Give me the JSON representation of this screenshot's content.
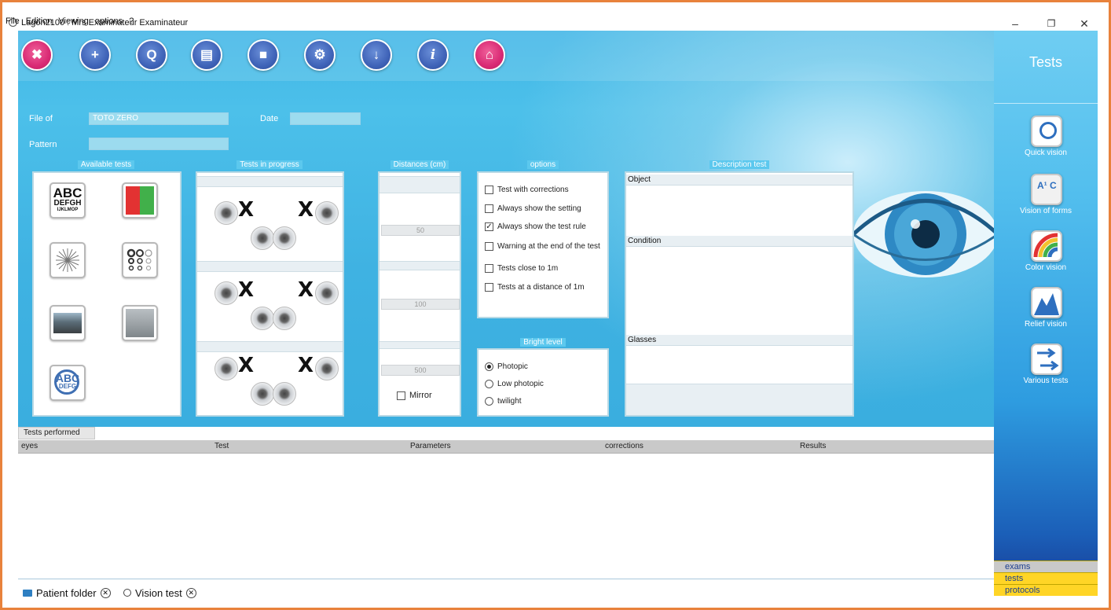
{
  "window": {
    "title": "Lagon2100 : Mrs Examinateur Examinateur",
    "minimize": "–",
    "restore": "❐",
    "close": "✕"
  },
  "menu": [
    "File",
    "Edition",
    "Viewing",
    "options",
    "?"
  ],
  "toolbar": {
    "buttons": [
      {
        "name": "close-session",
        "glyph": "✖"
      },
      {
        "name": "add-patient",
        "glyph": "+"
      },
      {
        "name": "search-patient",
        "glyph": "Q"
      },
      {
        "name": "open-folder",
        "glyph": "▤"
      },
      {
        "name": "save-record",
        "glyph": "■"
      },
      {
        "name": "settings",
        "glyph": "⚙"
      },
      {
        "name": "export",
        "glyph": "↓"
      },
      {
        "name": "info",
        "glyph": "i"
      },
      {
        "name": "home",
        "glyph": "⌂"
      }
    ]
  },
  "file_of": {
    "label": "File of",
    "value": "TOTO ZERO"
  },
  "date": {
    "label": "Date",
    "value": ""
  },
  "pattern": {
    "label": "Pattern",
    "value": ""
  },
  "available_tests": {
    "title": "Available tests",
    "tiles": [
      {
        "name": "abc-chart",
        "line1": "ABC",
        "line2": "DEFGH",
        "line3": "IJKLMOP"
      },
      {
        "name": "red-green-test"
      },
      {
        "name": "astigmatism-star"
      },
      {
        "name": "landolt-rings"
      },
      {
        "name": "photo-road-day"
      },
      {
        "name": "photo-road-fog"
      },
      {
        "name": "abc-magnify",
        "line1": "ABC",
        "line2": "DEFG"
      }
    ]
  },
  "tests_in_progress": {
    "title": "Tests in progress",
    "x": "X"
  },
  "distances": {
    "title": "Distances (cm)",
    "values": [
      "50",
      "100",
      "500"
    ],
    "mirror": "Mirror"
  },
  "options": {
    "title": "options",
    "items": [
      {
        "label": "Test with corrections",
        "checked": false
      },
      {
        "label": "Always show the setting",
        "checked": false
      },
      {
        "label": "Always show the test rule",
        "checked": true
      },
      {
        "label": "Warning at the end of the test",
        "checked": false
      },
      {
        "label": "Tests close to 1m",
        "checked": false
      },
      {
        "label": "Tests at a distance of 1m",
        "checked": false
      }
    ]
  },
  "bright_level": {
    "title": "Bright level",
    "items": [
      {
        "label": "Photopic",
        "selected": true
      },
      {
        "label": "Low photopic",
        "selected": false
      },
      {
        "label": "twilight",
        "selected": false
      }
    ]
  },
  "description": {
    "title": "Description test",
    "object": "Object",
    "condition": "Condition",
    "glasses": "Glasses"
  },
  "tests_performed": {
    "tab": "Tests performed",
    "columns": [
      "eyes",
      "Test",
      "Parameters",
      "corrections",
      "Results"
    ]
  },
  "bottom_tabs": [
    {
      "label": "Patient folder"
    },
    {
      "label": "Vision test"
    }
  ],
  "sidebar": {
    "title": "Tests",
    "items": [
      {
        "label": "Quick vision"
      },
      {
        "label": "Vision of forms"
      },
      {
        "label": "Color vision"
      },
      {
        "label": "Relief vision"
      },
      {
        "label": "Various tests"
      }
    ],
    "sections": [
      "exams",
      "tests",
      "protocols"
    ]
  },
  "colors": {
    "accent": "#e8823c",
    "blue": "#41b6e6",
    "pink": "#d92a74",
    "yellow": "#ffd526",
    "grey": "#bfbfbf"
  }
}
